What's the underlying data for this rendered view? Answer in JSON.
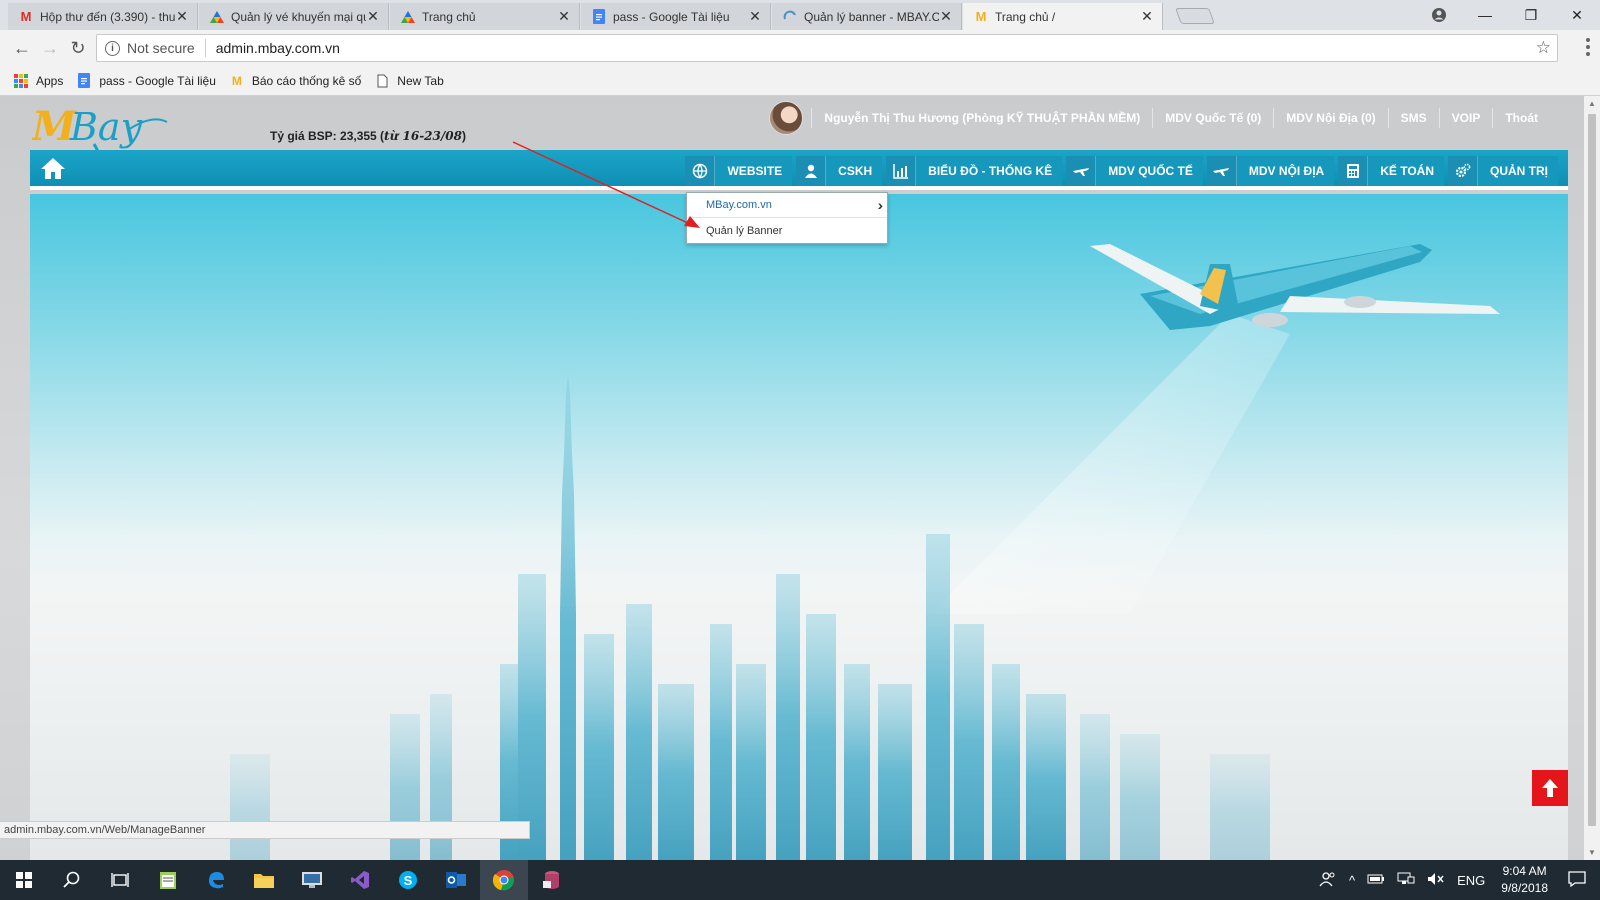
{
  "browser": {
    "tabs": [
      {
        "title": "Hộp thư đến (3.390) - thu",
        "favicon": "gmail-icon"
      },
      {
        "title": "Quản lý vé khuyến mại qu",
        "favicon": "drive-icon"
      },
      {
        "title": "Trang chủ",
        "favicon": "drive-icon"
      },
      {
        "title": "pass - Google Tài liệu",
        "favicon": "docs-icon"
      },
      {
        "title": "Quản lý banner - MBAY.C",
        "favicon": "loading-icon"
      },
      {
        "title": "Trang chủ /",
        "favicon": "mbay-icon",
        "active": true
      }
    ],
    "address": {
      "security": "Not secure",
      "url": "admin.mbay.com.vn"
    },
    "bookmarks": [
      {
        "label": "Apps",
        "icon": "apps-icon"
      },
      {
        "label": "pass - Google Tài liệu",
        "icon": "docs-icon"
      },
      {
        "label": "Báo cáo thống kê số",
        "icon": "mbay-icon"
      },
      {
        "label": "New Tab",
        "icon": "page-icon"
      }
    ],
    "status_url": "admin.mbay.com.vn/Web/ManageBanner"
  },
  "site": {
    "logo_text": "MBay",
    "exchange_rate": {
      "label": "Tỷ giá BSP: 23,355 (",
      "range": "từ 16-23/08",
      "close": ")"
    },
    "user_nav": [
      {
        "label": "Nguyễn Thị Thu Hương (Phòng KỸ THUẬT PHẦN MỀM)"
      },
      {
        "label": "MDV Quốc Tế (0)"
      },
      {
        "label": "MDV Nội Địa (0)"
      },
      {
        "label": "SMS"
      },
      {
        "label": "VOIP"
      },
      {
        "label": "Thoát"
      }
    ],
    "menu": [
      {
        "label": "WEBSITE",
        "icon": "globe-icon"
      },
      {
        "label": "CSKH",
        "icon": "user-icon"
      },
      {
        "label": "BIỂU ĐỒ - THỐNG KÊ",
        "icon": "bar-chart-icon"
      },
      {
        "label": "MDV QUỐC TẾ",
        "icon": "plane-icon"
      },
      {
        "label": "MDV NỘI ĐỊA",
        "icon": "plane-icon"
      },
      {
        "label": "KẾ TOÁN",
        "icon": "calculator-icon"
      },
      {
        "label": "QUẢN TRỊ",
        "icon": "gears-icon"
      }
    ],
    "dropdown": [
      {
        "label": "MBay.com.vn",
        "has_submenu": true
      },
      {
        "label": "Quản lý Banner"
      }
    ]
  },
  "taskbar": {
    "lang": "ENG",
    "time": "9:04 AM",
    "date": "9/8/2018"
  },
  "colors": {
    "menu_bar": "#1aa5c8",
    "to_top": "#e5161b",
    "arrow": "#e02020"
  }
}
